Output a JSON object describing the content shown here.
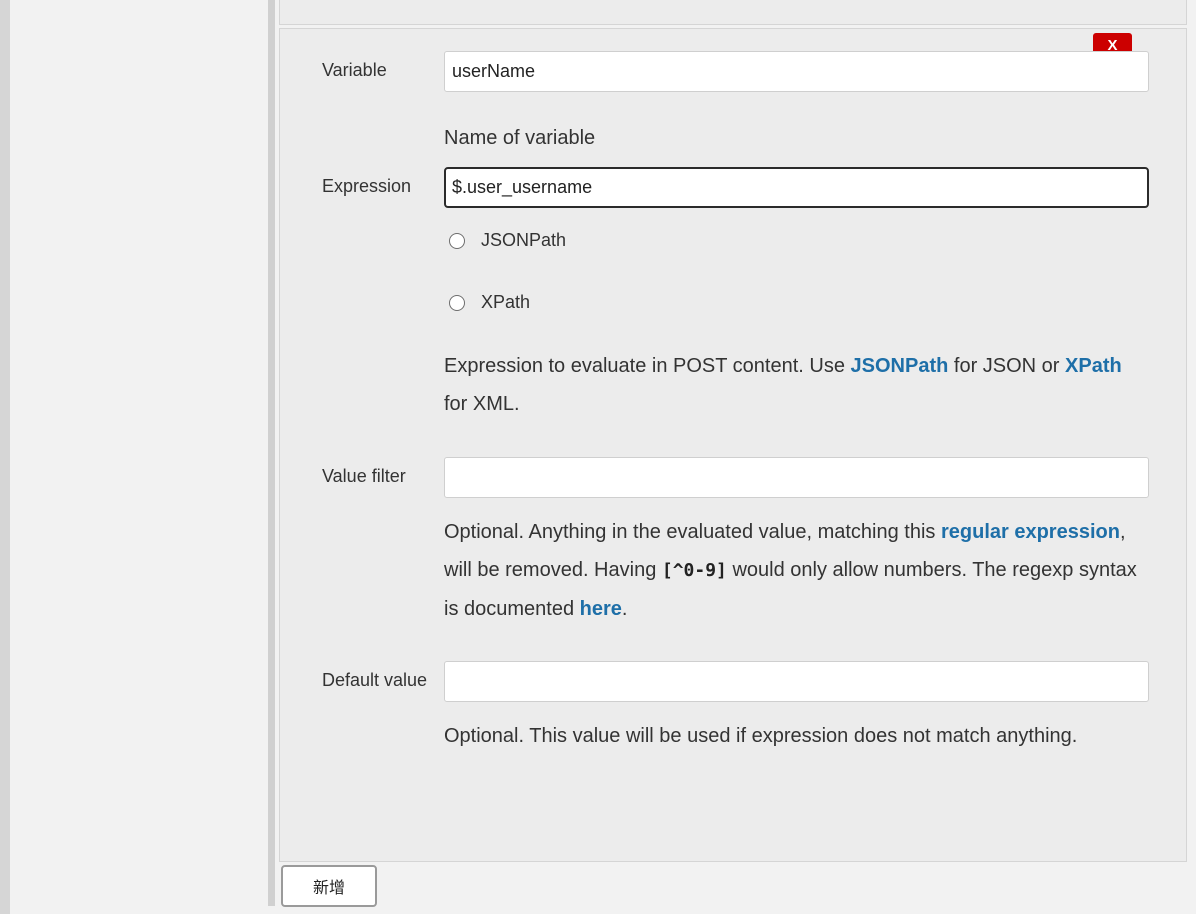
{
  "extractor": {
    "delete_label": "X",
    "variable": {
      "label": "Variable",
      "value": "userName",
      "help": "Name of variable"
    },
    "expression": {
      "label": "Expression",
      "value": "$.user_username",
      "options": [
        {
          "label": "JSONPath",
          "selected": false
        },
        {
          "label": "XPath",
          "selected": false
        }
      ],
      "help": {
        "part1": "Expression to evaluate in POST content. Use ",
        "link_jsonpath": "JSONPath",
        "part2": " for JSON or ",
        "link_xpath": "XPath",
        "part3": " for XML."
      }
    },
    "value_filter": {
      "label": "Value filter",
      "value": "",
      "help": {
        "part1": "Optional. Anything in the evaluated value, matching this ",
        "link_regex": "regular expression",
        "part2": ", will be removed. Having ",
        "code": "[^0-9]",
        "part3": " would only allow numbers. The regexp syntax is documented ",
        "link_here": "here",
        "part4": "."
      }
    },
    "default_value": {
      "label": "Default value",
      "value": "",
      "help": "Optional. This value will be used if expression does not match anything."
    }
  },
  "add_button_label": "新增"
}
